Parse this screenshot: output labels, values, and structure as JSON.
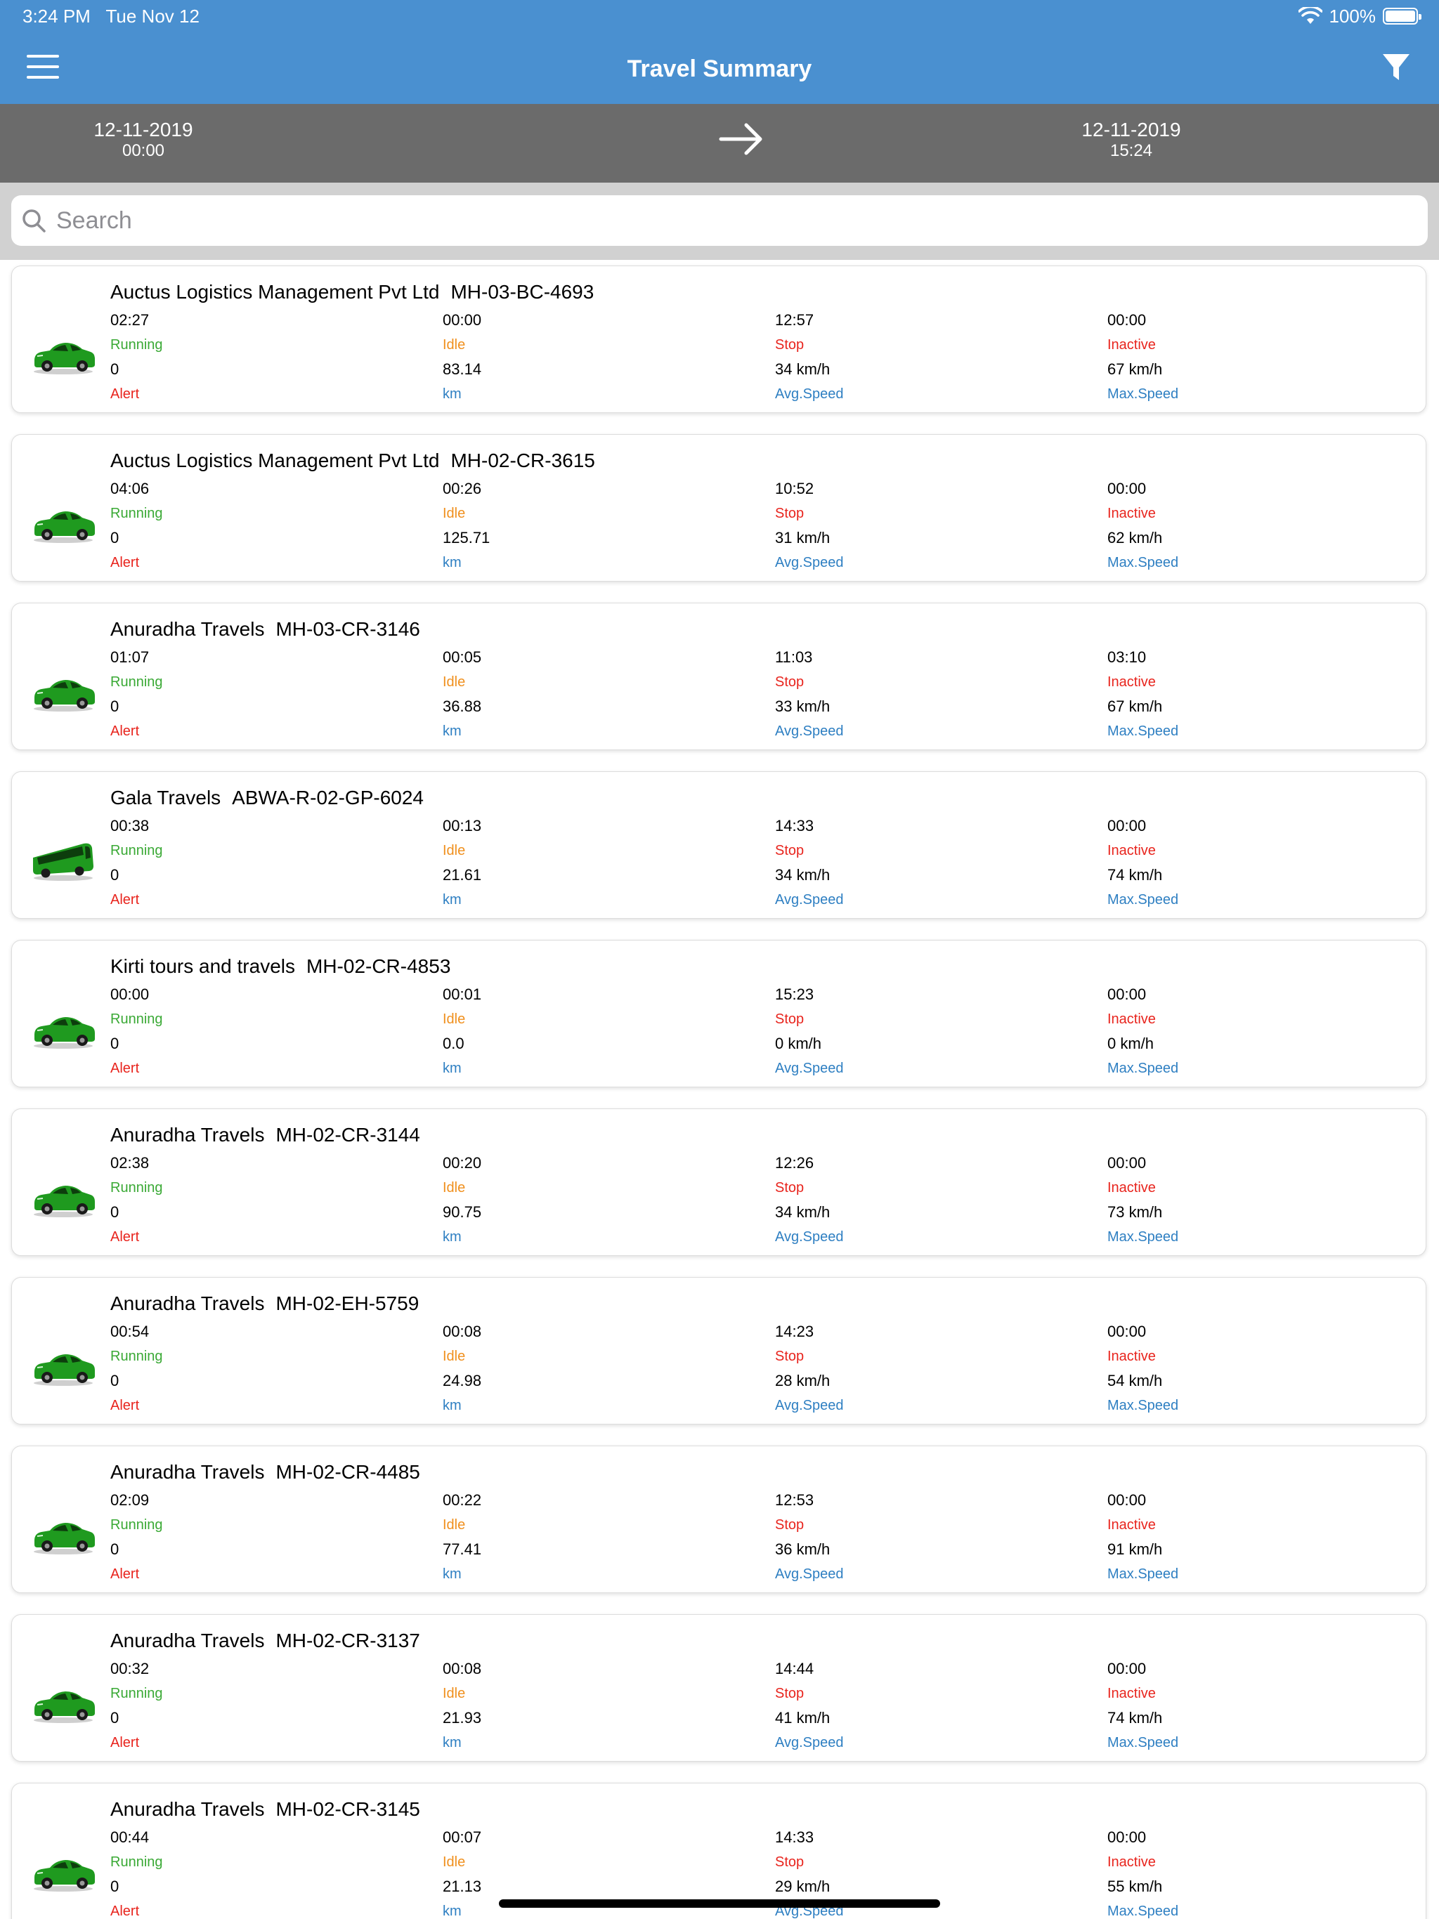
{
  "status": {
    "time": "3:24 PM",
    "date": "Tue Nov 12",
    "battery": "100%"
  },
  "nav": {
    "title": "Travel Summary",
    "menu_icon": "hamburger-icon",
    "filter_icon": "filter-icon"
  },
  "range": {
    "from": {
      "date": "12-11-2019",
      "time": "00:00"
    },
    "to": {
      "date": "12-11-2019",
      "time": "15:24"
    }
  },
  "search": {
    "placeholder": "Search",
    "value": ""
  },
  "labels": {
    "running": "Running",
    "idle": "Idle",
    "stop": "Stop",
    "inactive": "Inactive",
    "alert": "Alert",
    "km": "km",
    "avg": "Avg.Speed",
    "max": "Max.Speed"
  },
  "colors": {
    "header": "#4a90d0",
    "datebar": "#6b6b6b",
    "running": "#3aa935",
    "idle": "#f0901e",
    "stop": "#e8241d",
    "info": "#2e7fc2"
  },
  "vehicles": [
    {
      "company": "Auctus Logistics Management Pvt Ltd",
      "plate": "MH-03-BC-4693",
      "type": "car",
      "running": "02:27",
      "idle": "00:00",
      "stop": "12:57",
      "inactive": "00:00",
      "alert": "0",
      "km": "83.14",
      "avg": "34 km/h",
      "max": "67 km/h"
    },
    {
      "company": "Auctus Logistics Management Pvt Ltd",
      "plate": "MH-02-CR-3615",
      "type": "car",
      "running": "04:06",
      "idle": "00:26",
      "stop": "10:52",
      "inactive": "00:00",
      "alert": "0",
      "km": "125.71",
      "avg": "31 km/h",
      "max": "62 km/h"
    },
    {
      "company": "Anuradha Travels",
      "plate": "MH-03-CR-3146",
      "type": "car",
      "running": "01:07",
      "idle": "00:05",
      "stop": "11:03",
      "inactive": "03:10",
      "alert": "0",
      "km": "36.88",
      "avg": "33 km/h",
      "max": "67 km/h"
    },
    {
      "company": "Gala Travels",
      "plate": "ABWA-R-02-GP-6024",
      "type": "bus",
      "running": "00:38",
      "idle": "00:13",
      "stop": "14:33",
      "inactive": "00:00",
      "alert": "0",
      "km": "21.61",
      "avg": "34 km/h",
      "max": "74 km/h"
    },
    {
      "company": "Kirti tours and travels",
      "plate": "MH-02-CR-4853",
      "type": "car",
      "running": "00:00",
      "idle": "00:01",
      "stop": "15:23",
      "inactive": "00:00",
      "alert": "0",
      "km": "0.0",
      "avg": "0 km/h",
      "max": "0 km/h"
    },
    {
      "company": "Anuradha Travels",
      "plate": "MH-02-CR-3144",
      "type": "car",
      "running": "02:38",
      "idle": "00:20",
      "stop": "12:26",
      "inactive": "00:00",
      "alert": "0",
      "km": "90.75",
      "avg": "34 km/h",
      "max": "73 km/h"
    },
    {
      "company": "Anuradha Travels",
      "plate": "MH-02-EH-5759",
      "type": "car",
      "running": "00:54",
      "idle": "00:08",
      "stop": "14:23",
      "inactive": "00:00",
      "alert": "0",
      "km": "24.98",
      "avg": "28 km/h",
      "max": "54 km/h"
    },
    {
      "company": "Anuradha Travels",
      "plate": "MH-02-CR-4485",
      "type": "car",
      "running": "02:09",
      "idle": "00:22",
      "stop": "12:53",
      "inactive": "00:00",
      "alert": "0",
      "km": "77.41",
      "avg": "36 km/h",
      "max": "91 km/h"
    },
    {
      "company": "Anuradha Travels",
      "plate": "MH-02-CR-3137",
      "type": "car",
      "running": "00:32",
      "idle": "00:08",
      "stop": "14:44",
      "inactive": "00:00",
      "alert": "0",
      "km": "21.93",
      "avg": "41 km/h",
      "max": "74 km/h"
    },
    {
      "company": "Anuradha Travels",
      "plate": "MH-02-CR-3145",
      "type": "car",
      "running": "00:44",
      "idle": "00:07",
      "stop": "14:33",
      "inactive": "00:00",
      "alert": "0",
      "km": "21.13",
      "avg": "29 km/h",
      "max": "55 km/h"
    }
  ]
}
